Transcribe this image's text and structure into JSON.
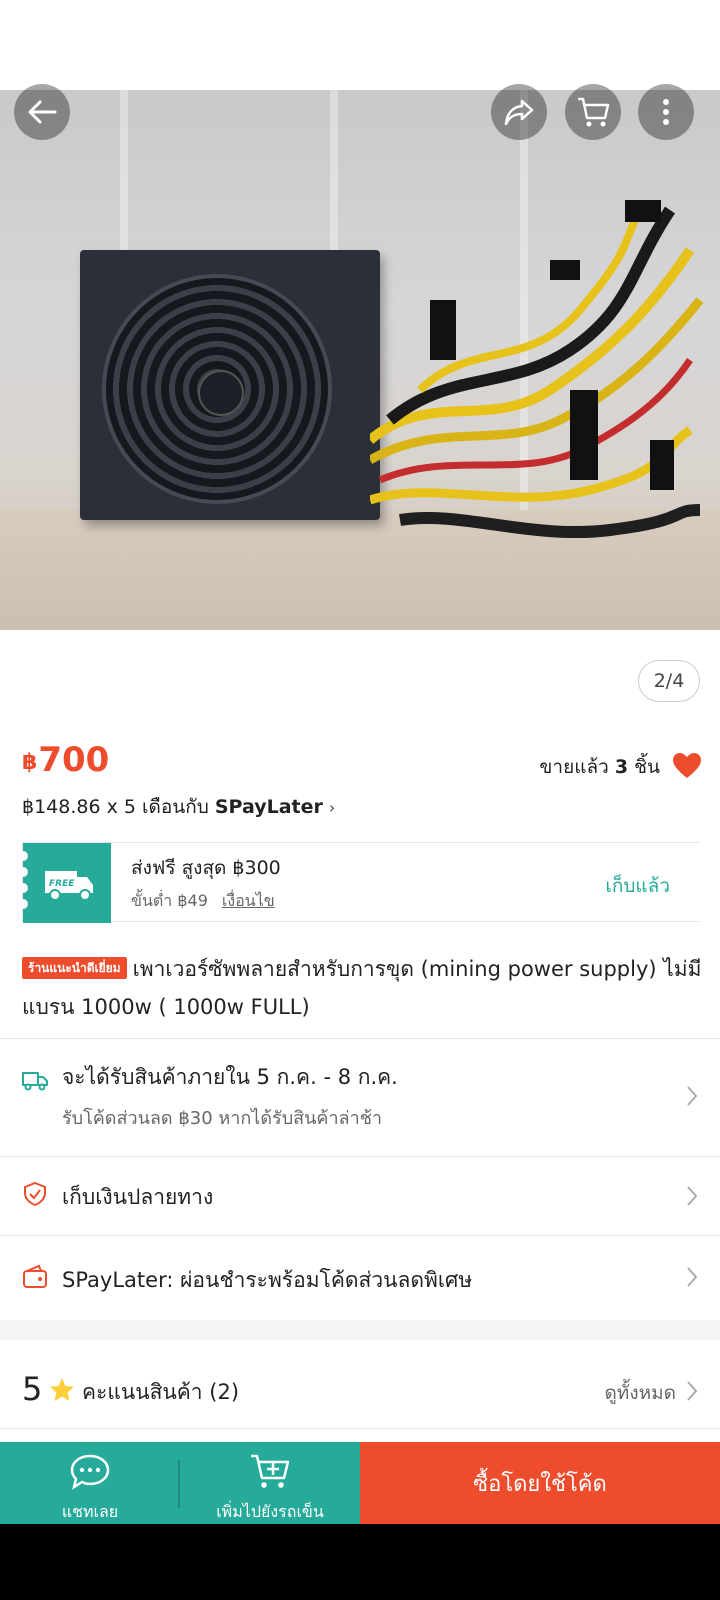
{
  "gallery": {
    "page_indicator": "2/4"
  },
  "top_actions": {
    "back_icon": "back-arrow-icon",
    "share_icon": "share-icon",
    "cart_icon": "cart-icon",
    "more_icon": "more-vertical-icon"
  },
  "price": {
    "currency": "฿",
    "amount": "700",
    "sold_prefix": "ขายแล้ว",
    "sold_count": "3",
    "sold_suffix": "ชิ้น",
    "installment_text": "฿148.86 x 5 เดือนกับ",
    "installment_brand": "SPayLater"
  },
  "voucher": {
    "badge_text": "FREE",
    "title": "ส่งฟรี สูงสุด ฿300",
    "min_spend": "ขั้นต่ำ ฿49",
    "conditions": "เงื่อนไข",
    "claim_label": "เก็บแล้ว"
  },
  "product": {
    "badge": "ร้านแนะนำดีเยี่ยม",
    "title": "เพาเวอร์ซัพพลายสำหรับการขุด (mining power supply) ไม่มีแบรน 1000w ( 1000w FULL)"
  },
  "shipping": {
    "title": "จะได้รับสินค้าภายใน 5 ก.ค. - 8 ก.ค.",
    "subtitle": "รับโค้ดส่วนลด ฿30 หากได้รับสินค้าล่าช้า"
  },
  "cod": {
    "title": "เก็บเงินปลายทาง"
  },
  "spaylater": {
    "title": "SPayLater: ผ่อนชำระพร้อมโค้ดส่วนลดพิเศษ"
  },
  "rating": {
    "score": "5",
    "label": "คะแนนสินค้า (2)",
    "see_all": "ดูทั้งหมด"
  },
  "bottom_bar": {
    "chat_label": "แชทเลย",
    "add_to_cart_label": "เพิ่มไปยังรถเข็น",
    "buy_label": "ซื้อโดยใช้โค้ด"
  },
  "colors": {
    "accent": "#ee4d2d",
    "teal": "#26aa99"
  }
}
